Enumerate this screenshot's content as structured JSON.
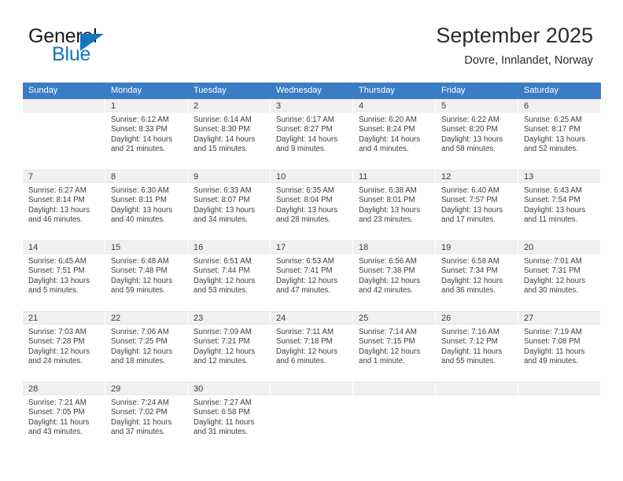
{
  "brand": {
    "name_part1": "General",
    "name_part2": "Blue",
    "flag_icon": "triangle-flag-icon",
    "accent_color": "#1277bd"
  },
  "header": {
    "title": "September 2025",
    "subtitle": "Dovre, Innlandet, Norway"
  },
  "theme": {
    "header_row_bg": "#3b7dc4",
    "day_number_bg": "#f0f0f0",
    "text_color": "#3d3d3d"
  },
  "day_headers": [
    "Sunday",
    "Monday",
    "Tuesday",
    "Wednesday",
    "Thursday",
    "Friday",
    "Saturday"
  ],
  "weeks": [
    [
      {
        "day": "",
        "lines": []
      },
      {
        "day": "1",
        "lines": [
          "Sunrise: 6:12 AM",
          "Sunset: 8:33 PM",
          "Daylight: 14 hours",
          "and 21 minutes."
        ]
      },
      {
        "day": "2",
        "lines": [
          "Sunrise: 6:14 AM",
          "Sunset: 8:30 PM",
          "Daylight: 14 hours",
          "and 15 minutes."
        ]
      },
      {
        "day": "3",
        "lines": [
          "Sunrise: 6:17 AM",
          "Sunset: 8:27 PM",
          "Daylight: 14 hours",
          "and 9 minutes."
        ]
      },
      {
        "day": "4",
        "lines": [
          "Sunrise: 6:20 AM",
          "Sunset: 8:24 PM",
          "Daylight: 14 hours",
          "and 4 minutes."
        ]
      },
      {
        "day": "5",
        "lines": [
          "Sunrise: 6:22 AM",
          "Sunset: 8:20 PM",
          "Daylight: 13 hours",
          "and 58 minutes."
        ]
      },
      {
        "day": "6",
        "lines": [
          "Sunrise: 6:25 AM",
          "Sunset: 8:17 PM",
          "Daylight: 13 hours",
          "and 52 minutes."
        ]
      }
    ],
    [
      {
        "day": "7",
        "lines": [
          "Sunrise: 6:27 AM",
          "Sunset: 8:14 PM",
          "Daylight: 13 hours",
          "and 46 minutes."
        ]
      },
      {
        "day": "8",
        "lines": [
          "Sunrise: 6:30 AM",
          "Sunset: 8:11 PM",
          "Daylight: 13 hours",
          "and 40 minutes."
        ]
      },
      {
        "day": "9",
        "lines": [
          "Sunrise: 6:33 AM",
          "Sunset: 8:07 PM",
          "Daylight: 13 hours",
          "and 34 minutes."
        ]
      },
      {
        "day": "10",
        "lines": [
          "Sunrise: 6:35 AM",
          "Sunset: 8:04 PM",
          "Daylight: 13 hours",
          "and 28 minutes."
        ]
      },
      {
        "day": "11",
        "lines": [
          "Sunrise: 6:38 AM",
          "Sunset: 8:01 PM",
          "Daylight: 13 hours",
          "and 23 minutes."
        ]
      },
      {
        "day": "12",
        "lines": [
          "Sunrise: 6:40 AM",
          "Sunset: 7:57 PM",
          "Daylight: 13 hours",
          "and 17 minutes."
        ]
      },
      {
        "day": "13",
        "lines": [
          "Sunrise: 6:43 AM",
          "Sunset: 7:54 PM",
          "Daylight: 13 hours",
          "and 11 minutes."
        ]
      }
    ],
    [
      {
        "day": "14",
        "lines": [
          "Sunrise: 6:45 AM",
          "Sunset: 7:51 PM",
          "Daylight: 13 hours",
          "and 5 minutes."
        ]
      },
      {
        "day": "15",
        "lines": [
          "Sunrise: 6:48 AM",
          "Sunset: 7:48 PM",
          "Daylight: 12 hours",
          "and 59 minutes."
        ]
      },
      {
        "day": "16",
        "lines": [
          "Sunrise: 6:51 AM",
          "Sunset: 7:44 PM",
          "Daylight: 12 hours",
          "and 53 minutes."
        ]
      },
      {
        "day": "17",
        "lines": [
          "Sunrise: 6:53 AM",
          "Sunset: 7:41 PM",
          "Daylight: 12 hours",
          "and 47 minutes."
        ]
      },
      {
        "day": "18",
        "lines": [
          "Sunrise: 6:56 AM",
          "Sunset: 7:38 PM",
          "Daylight: 12 hours",
          "and 42 minutes."
        ]
      },
      {
        "day": "19",
        "lines": [
          "Sunrise: 6:58 AM",
          "Sunset: 7:34 PM",
          "Daylight: 12 hours",
          "and 36 minutes."
        ]
      },
      {
        "day": "20",
        "lines": [
          "Sunrise: 7:01 AM",
          "Sunset: 7:31 PM",
          "Daylight: 12 hours",
          "and 30 minutes."
        ]
      }
    ],
    [
      {
        "day": "21",
        "lines": [
          "Sunrise: 7:03 AM",
          "Sunset: 7:28 PM",
          "Daylight: 12 hours",
          "and 24 minutes."
        ]
      },
      {
        "day": "22",
        "lines": [
          "Sunrise: 7:06 AM",
          "Sunset: 7:25 PM",
          "Daylight: 12 hours",
          "and 18 minutes."
        ]
      },
      {
        "day": "23",
        "lines": [
          "Sunrise: 7:09 AM",
          "Sunset: 7:21 PM",
          "Daylight: 12 hours",
          "and 12 minutes."
        ]
      },
      {
        "day": "24",
        "lines": [
          "Sunrise: 7:11 AM",
          "Sunset: 7:18 PM",
          "Daylight: 12 hours",
          "and 6 minutes."
        ]
      },
      {
        "day": "25",
        "lines": [
          "Sunrise: 7:14 AM",
          "Sunset: 7:15 PM",
          "Daylight: 12 hours",
          "and 1 minute."
        ]
      },
      {
        "day": "26",
        "lines": [
          "Sunrise: 7:16 AM",
          "Sunset: 7:12 PM",
          "Daylight: 11 hours",
          "and 55 minutes."
        ]
      },
      {
        "day": "27",
        "lines": [
          "Sunrise: 7:19 AM",
          "Sunset: 7:08 PM",
          "Daylight: 11 hours",
          "and 49 minutes."
        ]
      }
    ],
    [
      {
        "day": "28",
        "lines": [
          "Sunrise: 7:21 AM",
          "Sunset: 7:05 PM",
          "Daylight: 11 hours",
          "and 43 minutes."
        ]
      },
      {
        "day": "29",
        "lines": [
          "Sunrise: 7:24 AM",
          "Sunset: 7:02 PM",
          "Daylight: 11 hours",
          "and 37 minutes."
        ]
      },
      {
        "day": "30",
        "lines": [
          "Sunrise: 7:27 AM",
          "Sunset: 6:58 PM",
          "Daylight: 11 hours",
          "and 31 minutes."
        ]
      },
      {
        "day": "",
        "lines": []
      },
      {
        "day": "",
        "lines": []
      },
      {
        "day": "",
        "lines": []
      },
      {
        "day": "",
        "lines": []
      }
    ]
  ]
}
